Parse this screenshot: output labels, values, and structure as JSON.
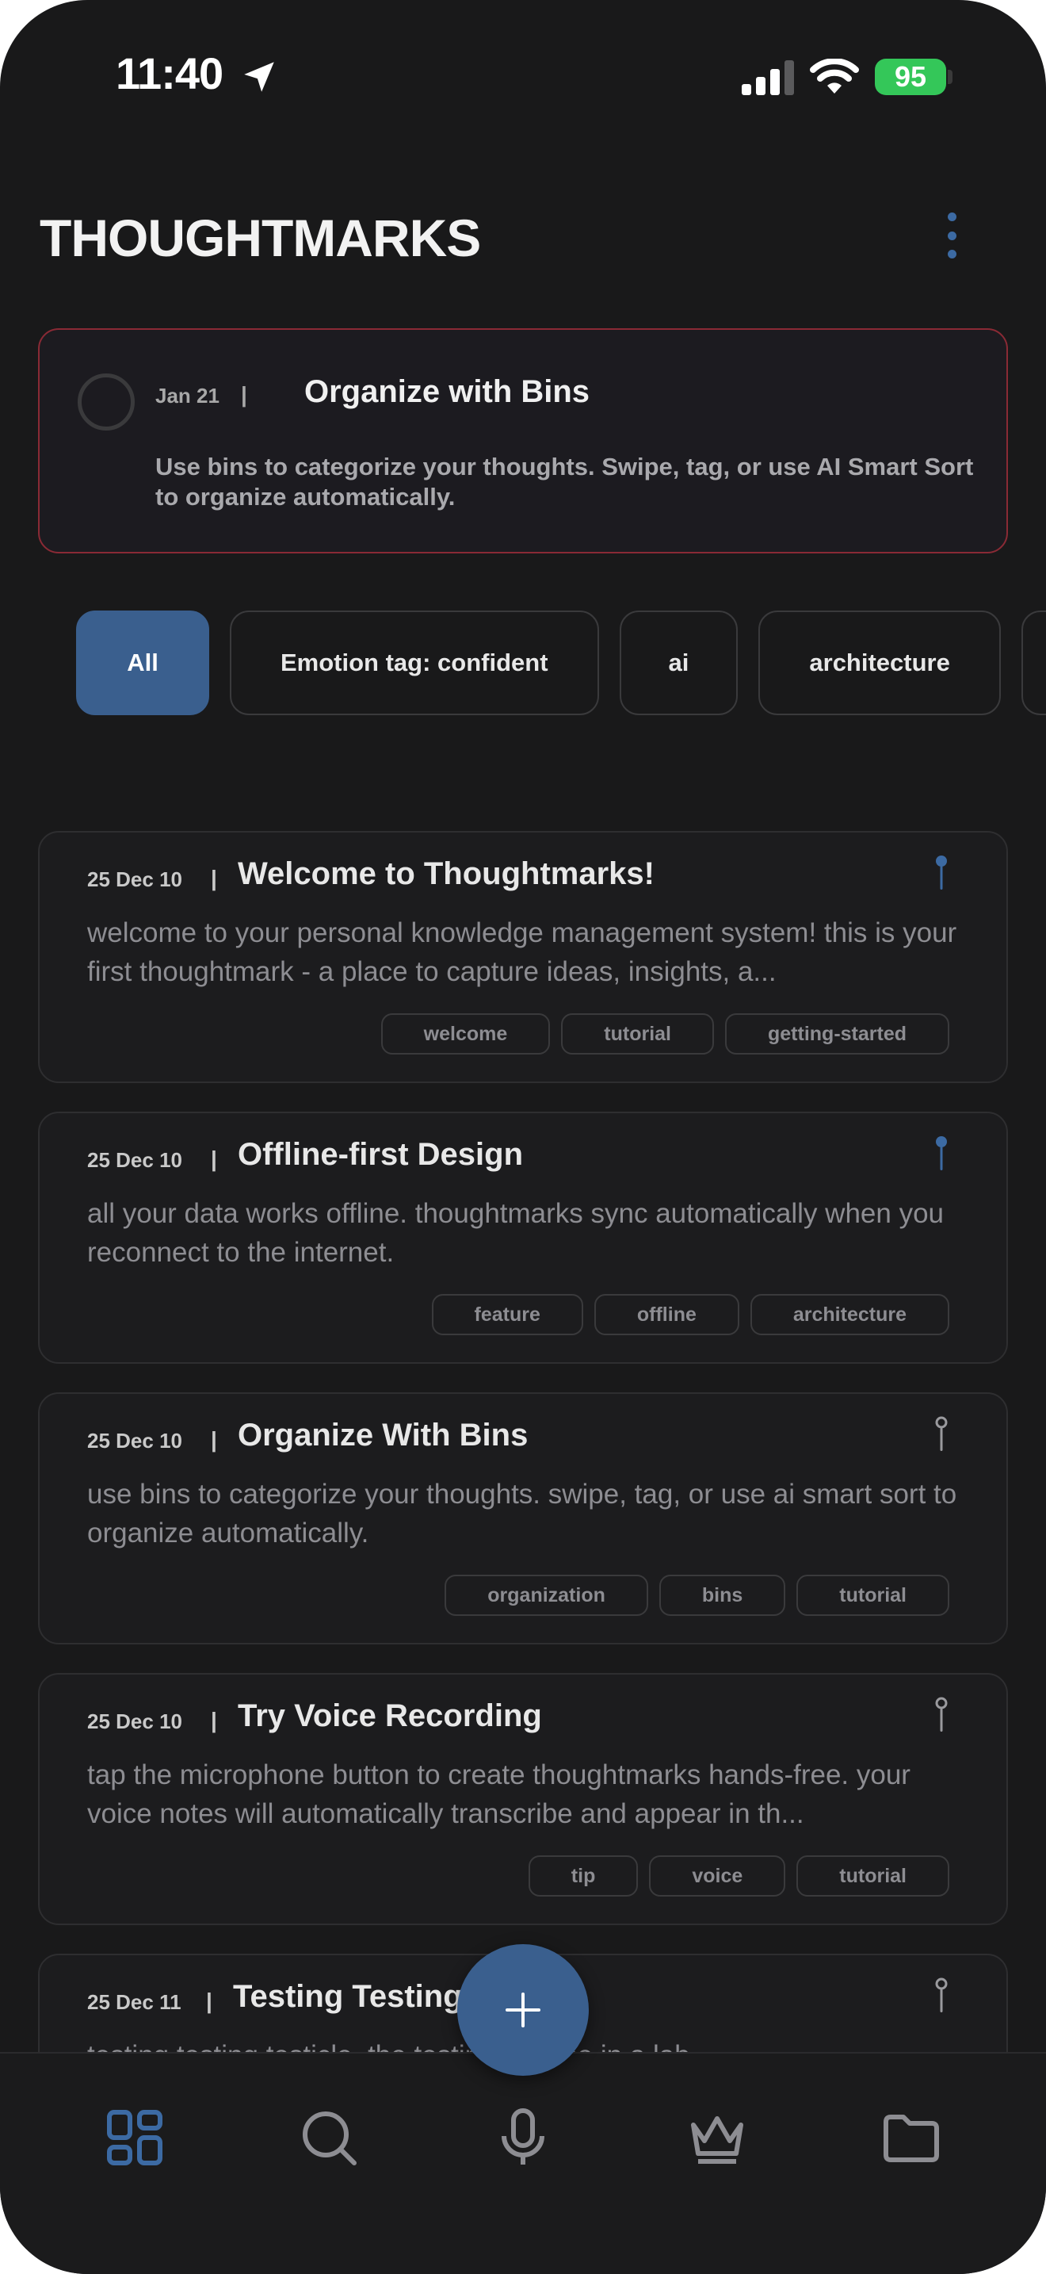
{
  "status": {
    "time": "11:40",
    "battery": "95"
  },
  "header": {
    "title": "THOUGHTMARKS"
  },
  "tip": {
    "date": "Jan 21",
    "separator": "|",
    "title": "Organize with Bins",
    "body": "Use bins to categorize your thoughts. Swipe, tag, or use AI Smart Sort to organize automatically."
  },
  "filters": [
    "All",
    "Emotion tag: confident",
    "ai",
    "architecture"
  ],
  "cards": [
    {
      "date": "25 Dec 10",
      "separator": "|",
      "title": "Welcome to Thoughtmarks!",
      "body": "welcome to your personal knowledge management system! this is your first thoughtmark - a place to capture ideas, insights, a...",
      "tags": [
        "welcome",
        "tutorial",
        "getting-started"
      ],
      "pinned": true
    },
    {
      "date": "25 Dec 10",
      "separator": "|",
      "title": "Offline-first Design",
      "body": "all your data works offline. thoughtmarks sync automatically when you reconnect to the internet.",
      "tags": [
        "feature",
        "offline",
        "architecture"
      ],
      "pinned": true
    },
    {
      "date": "25 Dec 10",
      "separator": "|",
      "title": "Organize With Bins",
      "body": "use bins to categorize your thoughts. swipe, tag, or use ai smart sort to organize automatically.",
      "tags": [
        "organization",
        "bins",
        "tutorial"
      ],
      "pinned": false
    },
    {
      "date": "25 Dec 10",
      "separator": "|",
      "title": "Try Voice Recording",
      "body": "tap the microphone button to create thoughtmarks hands-free. your voice notes will automatically transcribe and appear in th...",
      "tags": [
        "tip",
        "voice",
        "tutorial"
      ],
      "pinned": false
    },
    {
      "date": "25 Dec 11",
      "separator": "|",
      "title": "Testing Testing Testicle",
      "body": "testing testing testicle, the testing is done in a lab.",
      "tags": [],
      "pinned": false
    }
  ],
  "colors": {
    "accent": "#3a5f8e",
    "tip_border": "#8a2a35",
    "battery": "#34c759"
  },
  "tabbar": {
    "icons": [
      "grid-icon",
      "search-icon",
      "microphone-icon",
      "crown-icon",
      "folder-icon"
    ]
  }
}
